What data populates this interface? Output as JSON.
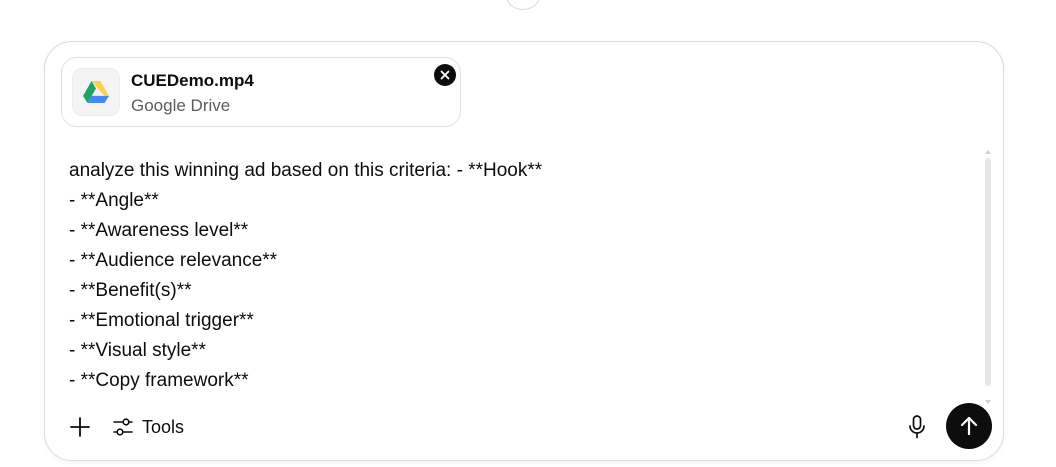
{
  "attachment": {
    "file_name": "CUEDemo.mp4",
    "source": "Google Drive",
    "thumbnail_icon": "google-drive-icon",
    "remove_icon": "close-icon"
  },
  "prompt": {
    "lines": [
      "analyze this winning ad based on this criteria: - **Hook**",
      "- **Angle**",
      "- **Awareness level**",
      "- **Audience relevance**",
      "- **Benefit(s)**",
      "- **Emotional trigger**",
      "- **Visual style**",
      "- **Copy framework**"
    ]
  },
  "toolbar": {
    "add_icon": "plus-icon",
    "tools_icon": "sliders-icon",
    "tools_label": "Tools",
    "mic_icon": "microphone-icon",
    "send_icon": "arrow-up-icon"
  },
  "colors": {
    "text": "#0d0d0d",
    "secondary_text": "#5d5d5d",
    "send_button": "#0d0d0d",
    "drive_green": "#1fa463",
    "drive_yellow": "#ffd04b",
    "drive_blue": "#4688f4"
  }
}
